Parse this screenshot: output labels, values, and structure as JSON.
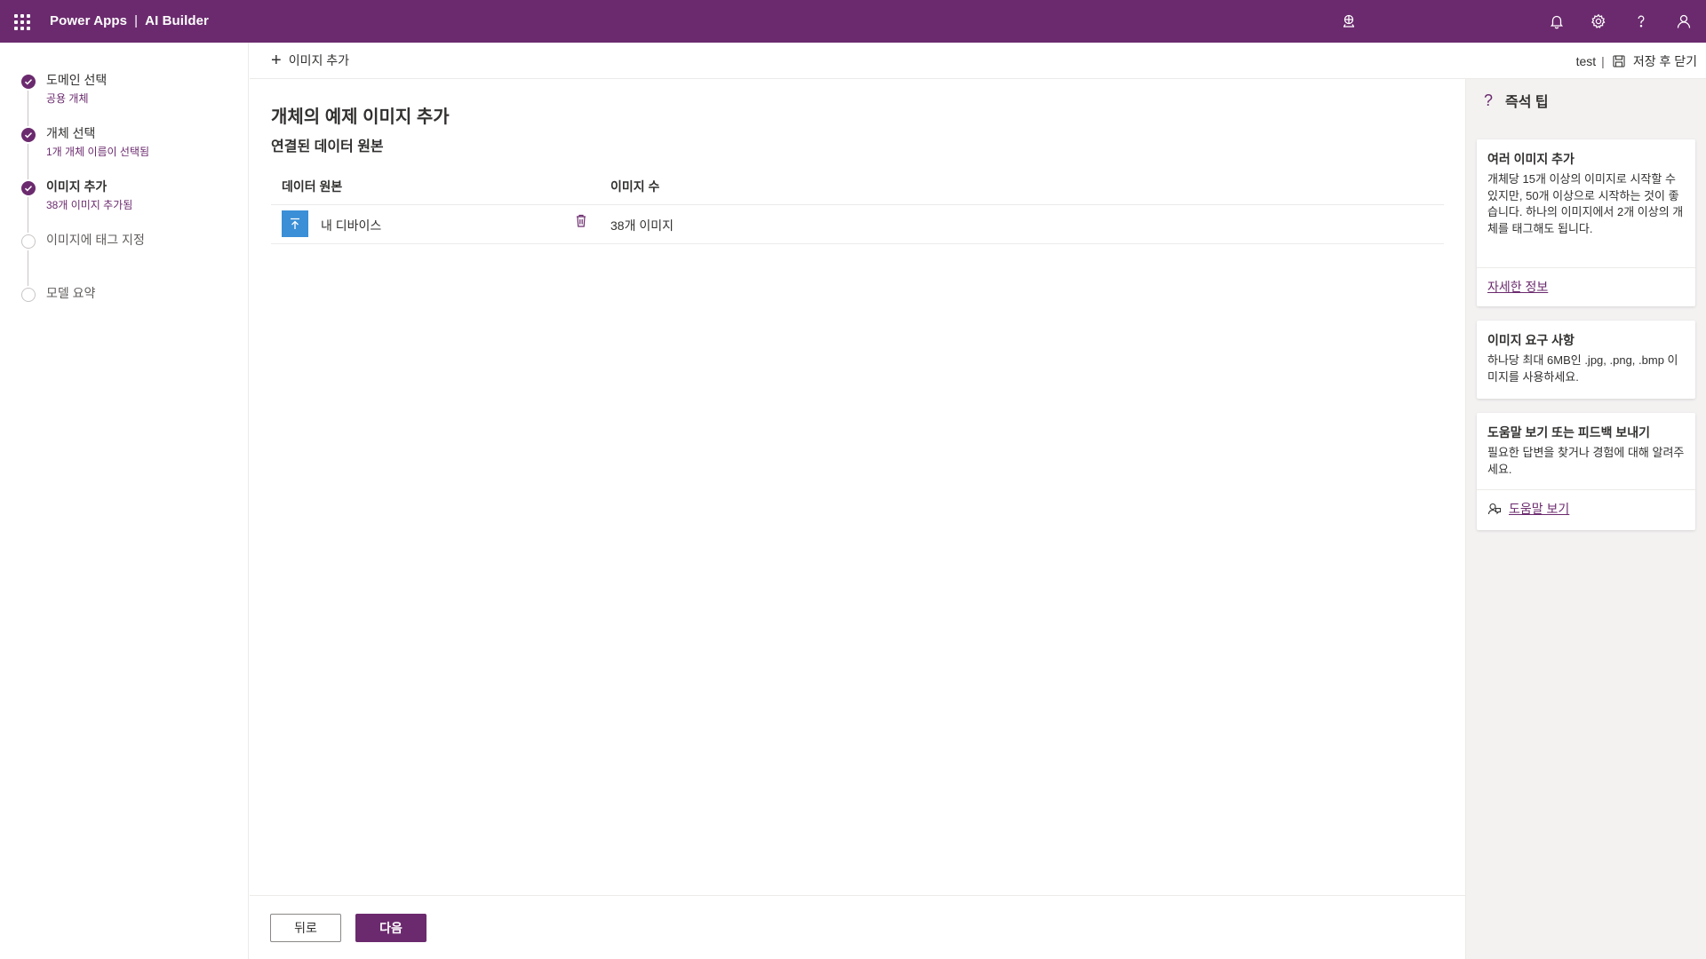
{
  "app": {
    "product": "Power Apps",
    "separator": "|",
    "section": "AI Builder",
    "colors": {
      "brand": "#6b2a6e",
      "device_icon_bg": "#3a8fd6"
    }
  },
  "topbar": {
    "icons": [
      "waffle-icon",
      "environment-icon",
      "notification-bell-icon",
      "settings-gear-icon",
      "help-question-icon",
      "account-person-icon"
    ]
  },
  "steps": [
    {
      "title": "도메인 선택",
      "subtitle": "공용 개체",
      "state": "done"
    },
    {
      "title": "개체 선택",
      "subtitle": "1개 개체 이름이 선택됨",
      "state": "done"
    },
    {
      "title": "이미지 추가",
      "subtitle": "38개 이미지 추가됨",
      "state": "current"
    },
    {
      "title": "이미지에 태그 지정",
      "subtitle": "",
      "state": "todo"
    },
    {
      "title": "모델 요약",
      "subtitle": "",
      "state": "todo"
    }
  ],
  "command_bar": {
    "add_images": "이미지 추가",
    "model_name": "test",
    "pipe": "|",
    "save_close": "저장 후 닫기"
  },
  "main": {
    "heading": "개체의 예제 이미지 추가",
    "subheading": "연결된 데이터 원본",
    "columns": [
      "데이터 원본",
      "이미지 수"
    ],
    "rows": [
      {
        "source": "내 디바이스",
        "count": "38개 이미지"
      }
    ]
  },
  "footer": {
    "back": "뒤로",
    "next": "다음"
  },
  "tips": {
    "title": "즉석 팁",
    "cards": [
      {
        "title": "여러 이미지 추가",
        "body": "개체당 15개 이상의 이미지로 시작할 수 있지만, 50개 이상으로 시작하는 것이 좋습니다. 하나의 이미지에서 2개 이상의 개체를 태그해도 됩니다.",
        "link": "자세한 정보"
      },
      {
        "title": "이미지 요구 사항",
        "body": "하나당 최대 6MB인 .jpg, .png, .bmp 이미지를 사용하세요."
      },
      {
        "title": "도움말 보기 또는 피드백 보내기",
        "body": "필요한 답변을 찾거나 경험에 대해 알려주세요.",
        "link": "도움말 보기"
      }
    ]
  }
}
